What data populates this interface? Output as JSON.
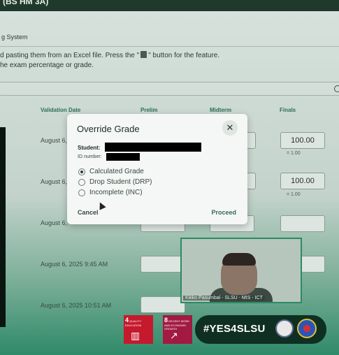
{
  "window": {
    "title": "(BS HM 3A)"
  },
  "page": {
    "subtitle": "g System",
    "instructions": [
      "d pasting them from an Excel file. Press the \"",
      "\" button for the feature.",
      "he exam percentage or grade."
    ],
    "columns": [
      "Validation Date",
      "Prelim",
      "Midterm",
      "Finals"
    ],
    "rows": [
      {
        "date": "August 6,",
        "final": "100.00",
        "eq": "= 1.00"
      },
      {
        "date": "August 6,",
        "final": "100.00",
        "eq": "= 1.00"
      },
      {
        "date": "August 6,",
        "final": "",
        "eq": ""
      },
      {
        "date": "August 6, 2025 9:45 AM",
        "final": "",
        "eq": ""
      },
      {
        "date": "August 6, 2025 10:51 AM",
        "final": "",
        "eq": ""
      }
    ]
  },
  "modal": {
    "title": "Override Grade",
    "close": "✕",
    "student_label": "Student:",
    "id_label": "ID number:",
    "options": [
      "Calculated Grade",
      "Drop Student (DRP)",
      "Incomplete (INC)"
    ],
    "selected": 0,
    "cancel": "Cancel",
    "proceed": "Proceed"
  },
  "video": {
    "caption": "Kikko Pasumbal - SLSU - MIS - ICT"
  },
  "branding": {
    "sdg4": {
      "num": "4",
      "title": "QUALITY EDUCATION"
    },
    "sdg8": {
      "num": "8",
      "title": "DECENT WORK AND ECONOMIC GROWTH"
    },
    "hashtag": "#YES4SLSU"
  },
  "colors": {
    "accent": "#2e6e55",
    "dark": "#0f2f23",
    "sdg4": "#c5192d",
    "sdg8": "#a21942"
  }
}
